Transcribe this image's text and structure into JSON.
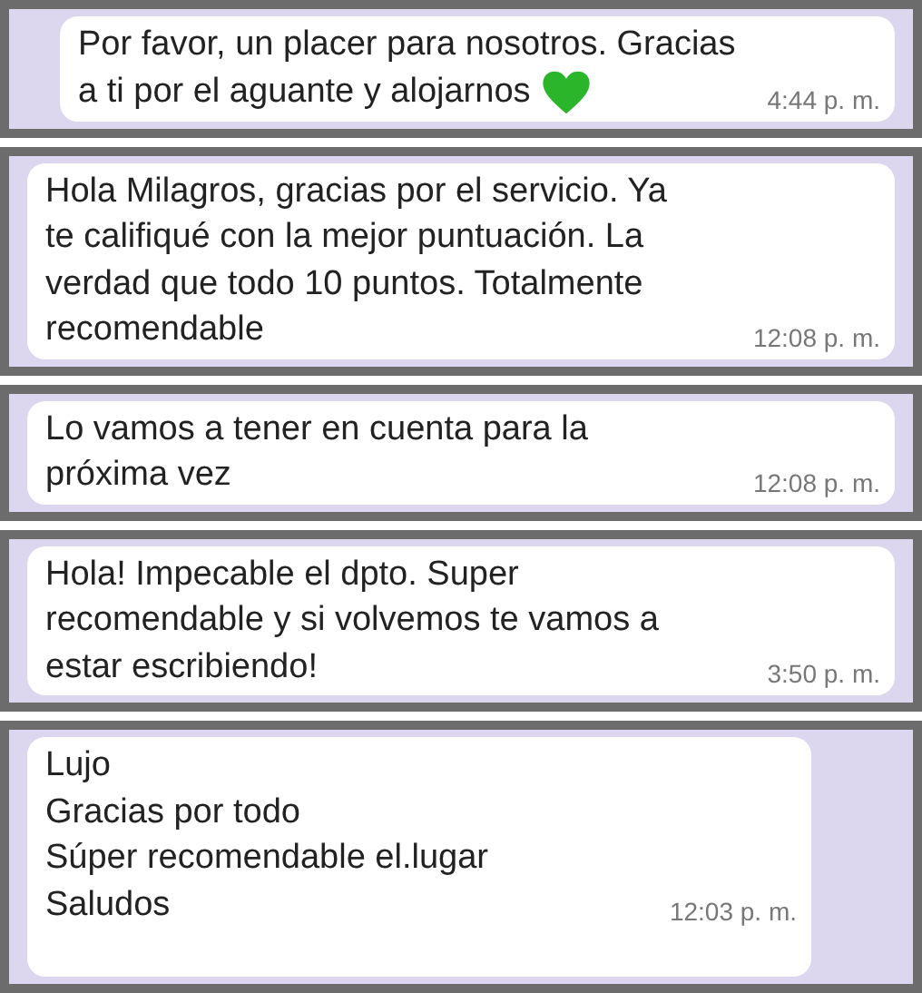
{
  "messages": [
    {
      "lines": [
        "Por favor, un placer para nosotros. Gracias",
        "a ti por el aguante y alojarnos"
      ],
      "heart": true,
      "time": "4:44 p. m."
    },
    {
      "lines": [
        "Hola Milagros, gracias por el servicio. Ya",
        "te califiqué con la mejor puntuación. La",
        "verdad que todo 10 puntos. Totalmente",
        "recomendable"
      ],
      "time": "12:08 p. m."
    },
    {
      "lines": [
        "Lo vamos a tener en cuenta para la",
        "próxima vez"
      ],
      "time": "12:08 p. m."
    },
    {
      "lines": [
        "Hola! Impecable el dpto. Super",
        "recomendable y si volvemos te vamos a",
        "estar escribiendo!"
      ],
      "time": "3:50 p. m."
    },
    {
      "lines": [
        "Lujo",
        "Gracias por todo",
        "Súper recomendable el.lugar",
        "Saludos"
      ],
      "time": "12:03 p. m."
    }
  ]
}
